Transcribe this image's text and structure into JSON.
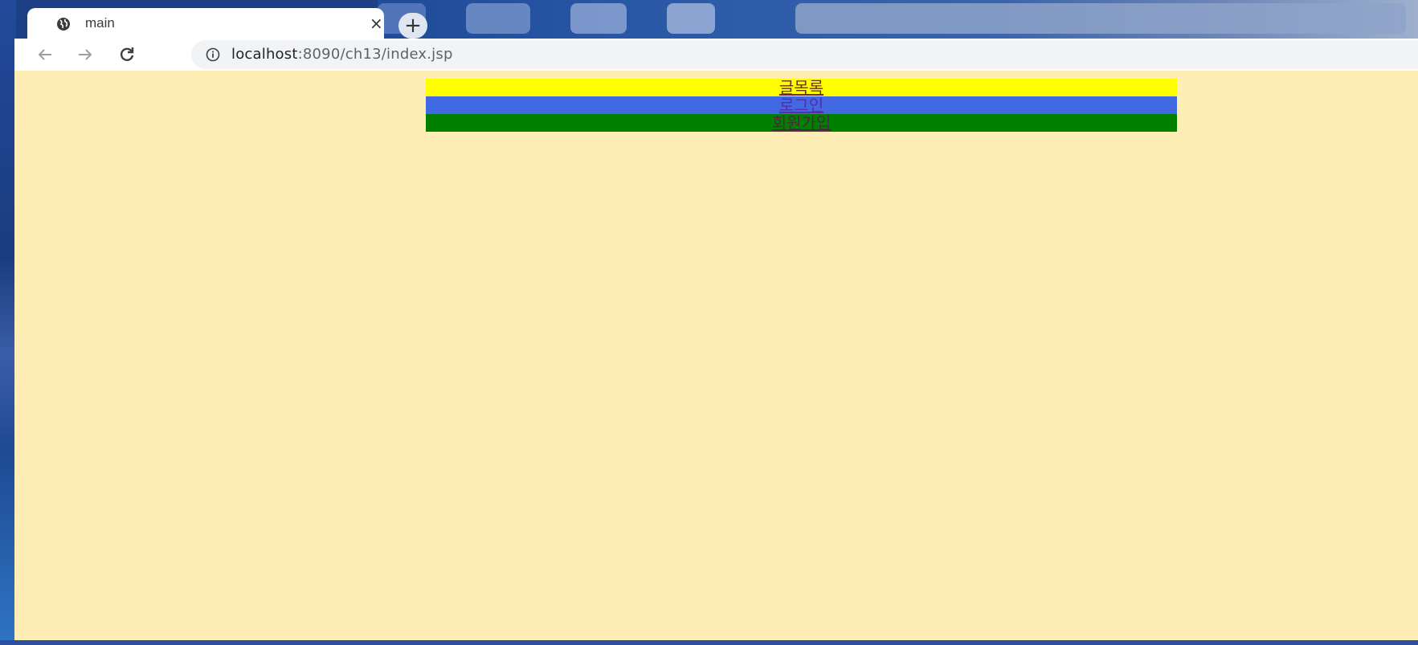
{
  "browser": {
    "tab": {
      "title": "main",
      "close_glyph": "×",
      "icon": "globe-icon"
    },
    "new_tab_glyph": "+",
    "nav": {
      "back_icon": "back-arrow-icon",
      "forward_icon": "forward-arrow-icon",
      "reload_icon": "reload-icon"
    },
    "address": {
      "host": "localhost",
      "path": ":8090/ch13/index.jsp",
      "icon": "info-icon"
    }
  },
  "page": {
    "background": "#feedb4",
    "menu": [
      {
        "label": "글목록",
        "color": "#ffff00"
      },
      {
        "label": "로그인",
        "color": "#4169e1"
      },
      {
        "label": "회원가입",
        "color": "#008000"
      }
    ]
  }
}
